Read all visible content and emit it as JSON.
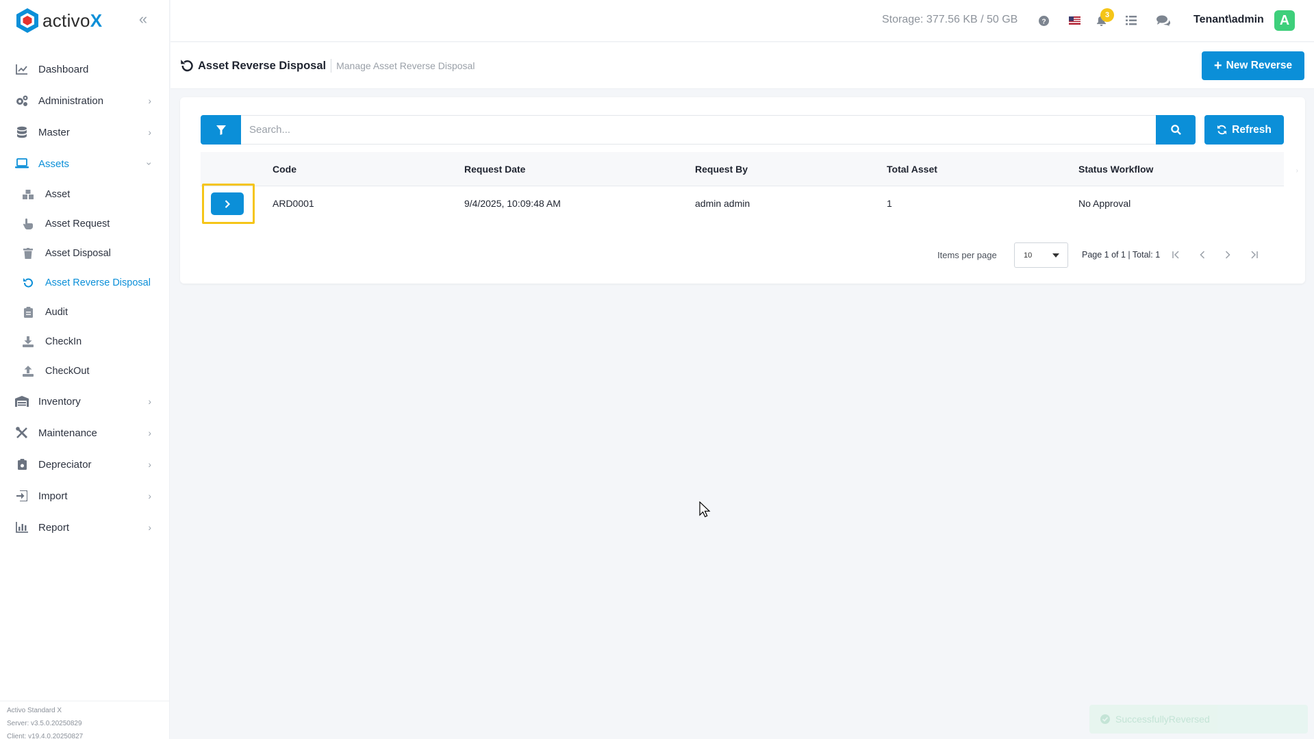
{
  "brand": {
    "name_prefix": "activo",
    "name_suffix": "X"
  },
  "sidebar": {
    "items": [
      {
        "label": "Dashboard",
        "icon": "chart-line-icon",
        "has_children": false
      },
      {
        "label": "Administration",
        "icon": "gears-icon",
        "has_children": true
      },
      {
        "label": "Master",
        "icon": "database-icon",
        "has_children": true
      },
      {
        "label": "Assets",
        "icon": "laptop-icon",
        "has_children": true,
        "open": true
      },
      {
        "label": "Inventory",
        "icon": "warehouse-icon",
        "has_children": true
      },
      {
        "label": "Maintenance",
        "icon": "tools-icon",
        "has_children": true
      },
      {
        "label": "Depreciator",
        "icon": "clipboard-icon",
        "has_children": true
      },
      {
        "label": "Import",
        "icon": "import-icon",
        "has_children": true
      },
      {
        "label": "Report",
        "icon": "bar-chart-icon",
        "has_children": true
      }
    ],
    "asset_children": [
      {
        "label": "Asset",
        "icon": "boxes-icon"
      },
      {
        "label": "Asset Request",
        "icon": "hand-pointer-icon"
      },
      {
        "label": "Asset Disposal",
        "icon": "trash-icon"
      },
      {
        "label": "Asset Reverse Disposal",
        "icon": "undo-icon",
        "active": true
      },
      {
        "label": "Audit",
        "icon": "clipboard-list-icon"
      },
      {
        "label": "CheckIn",
        "icon": "download-icon"
      },
      {
        "label": "CheckOut",
        "icon": "upload-icon"
      }
    ],
    "footer": {
      "product": "Activo Standard X",
      "server": "Server: v3.5.0.20250829",
      "client": "Client: v19.4.0.20250827"
    }
  },
  "topbar": {
    "storage": "Storage: 377.56 KB / 50 GB",
    "notification_count": "3",
    "user": "Tenant\\admin",
    "avatar_letter": "A"
  },
  "page": {
    "title": "Asset Reverse Disposal",
    "subtitle": "Manage Asset Reverse Disposal",
    "new_button": "New Reverse"
  },
  "search": {
    "placeholder": "Search...",
    "refresh_label": "Refresh"
  },
  "table": {
    "columns": [
      "Code",
      "Request Date",
      "Request By",
      "Total Asset",
      "Status Workflow"
    ],
    "rows": [
      {
        "code": "ARD0001",
        "request_date": "9/4/2025, 10:09:48 AM",
        "request_by": "admin admin",
        "total_asset": "1",
        "status": "No Approval"
      }
    ]
  },
  "pagination": {
    "items_per_page_label": "Items per page",
    "items_per_page": "10",
    "info": "Page 1 of 1 | Total: 1"
  },
  "toast": {
    "message": "SuccessfullyReversed"
  },
  "colors": {
    "primary": "#0b8fd8",
    "highlight": "#f5c518",
    "avatar": "#3ecf7b"
  }
}
